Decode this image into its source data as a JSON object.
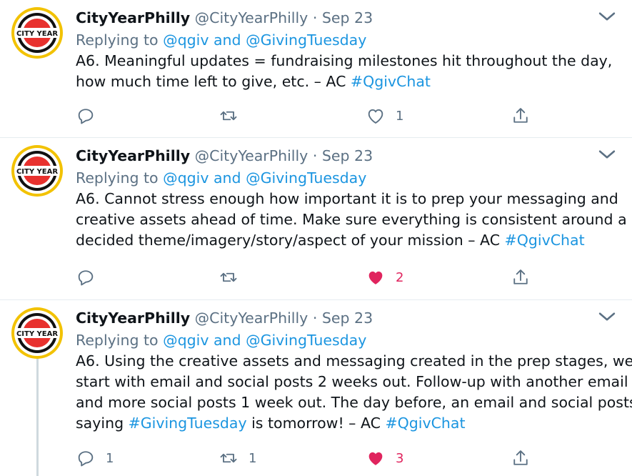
{
  "colors": {
    "link": "#1b95e0",
    "muted": "#5b7083",
    "liked": "#e0245e",
    "divider": "#e6ecf0"
  },
  "tweets": [
    {
      "name": "CityYearPhilly",
      "handle": "@CityYearPhilly",
      "dot": "·",
      "date": "Sep 23",
      "replying_prefix": "Replying to ",
      "replying_user1": "@qgiv",
      "replying_and": " and ",
      "replying_user2": "@GivingTuesday",
      "lines": [
        {
          "text": "A6. Meaningful updates = fundraising milestones hit throughout the day,",
          "tag": ""
        },
        {
          "text": "how much time left to give, etc. – AC ",
          "tag": "#QgivChat"
        }
      ],
      "reply_count": "",
      "retweet_count": "",
      "like_count": "1",
      "liked": false
    },
    {
      "name": "CityYearPhilly",
      "handle": "@CityYearPhilly",
      "dot": "·",
      "date": "Sep 23",
      "replying_prefix": "Replying to ",
      "replying_user1": "@qgiv",
      "replying_and": " and ",
      "replying_user2": "@GivingTuesday",
      "lines": [
        {
          "text": "A6. Cannot stress enough how important it is to prep your messaging and",
          "tag": ""
        },
        {
          "text": "creative assets ahead of time. Make sure everything is consistent around a",
          "tag": ""
        },
        {
          "text": "decided theme/imagery/story/aspect of your mission – AC ",
          "tag": "#QgivChat"
        }
      ],
      "reply_count": "",
      "retweet_count": "",
      "like_count": "2",
      "liked": true
    },
    {
      "name": "CityYearPhilly",
      "handle": "@CityYearPhilly",
      "dot": "·",
      "date": "Sep 23",
      "replying_prefix": "Replying to ",
      "replying_user1": "@qgiv",
      "replying_and": " and ",
      "replying_user2": "@GivingTuesday",
      "lines": [
        {
          "text": "A6. Using the creative assets and messaging created in the prep stages, we",
          "tag": "",
          "after": ""
        },
        {
          "text": "start with email and social posts 2 weeks out. Follow-up with another email",
          "tag": "",
          "after": ""
        },
        {
          "text": "and more social posts 1 week out. The day before, an email and social posts",
          "tag": "",
          "after": ""
        },
        {
          "text": "saying ",
          "tag": "#GivingTuesday",
          "after": " is tomorrow! – AC ",
          "tag2": "#QgivChat"
        }
      ],
      "reply_count": "1",
      "retweet_count": "1",
      "like_count": "3",
      "liked": true
    }
  ],
  "avatar": {
    "top_text": "CITY",
    "right_text": "YEAR",
    "icon": "city-year-logo"
  }
}
